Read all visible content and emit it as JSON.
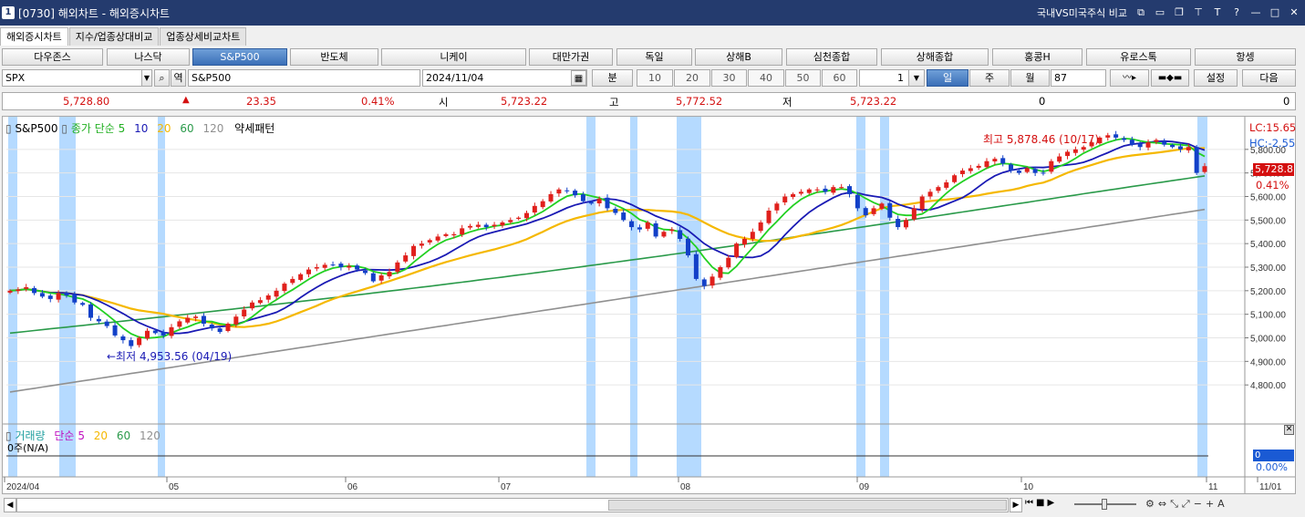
{
  "window": {
    "id": "1",
    "title": "[0730]  해외차트 - 해외증시차트",
    "right_label": "국내VS미국주식 비교"
  },
  "tabs": [
    "해외증시차트",
    "지수/업종상대비교",
    "업종상세비교차트"
  ],
  "markets": [
    "다우존스",
    "나스닥",
    "S&P500",
    "반도체",
    "니케이",
    "대만가권",
    "독일",
    "상해B",
    "심천종합",
    "상해종합",
    "홍콩H",
    "유로스톡",
    "항셍"
  ],
  "active_market": 2,
  "symbol": {
    "code": "SPX",
    "name": "S&P500",
    "date": "2024/11/04",
    "unit": "분"
  },
  "minute_options": [
    "10",
    "20",
    "30",
    "40",
    "50",
    "60"
  ],
  "count_value": "1",
  "periods": [
    "일",
    "주",
    "월"
  ],
  "period_count": "87",
  "buttons": {
    "settings": "설정",
    "next": "다음"
  },
  "quote": {
    "price": "5,728.80",
    "change_arrow": "▲",
    "change": "23.35",
    "change_pct": "0.41%",
    "open_label": "시",
    "open": "5,723.22",
    "high_label": "고",
    "high": "5,772.52",
    "low_label": "저",
    "low": "5,723.22",
    "volume": "0",
    "volume2": "0"
  },
  "legend": {
    "name": "S&P500",
    "ma_label": "종가 단순",
    "ma": [
      "5",
      "10",
      "20",
      "60",
      "120"
    ],
    "pattern": "약세패턴"
  },
  "vol_legend": {
    "name": "거래량",
    "ma_label": "단순",
    "ma": [
      "5",
      "20",
      "60",
      "120"
    ],
    "value": "0주(N/A)"
  },
  "annotations": {
    "high": "최고 5,878.46 (10/17)",
    "low": "←최저 4,953.56 (04/19)"
  },
  "right_axis": {
    "lc": "LC:15.65",
    "hc": "HC:-2.55",
    "price_tag": "5,728.8",
    "pct": "0.41%",
    "vol_tag": "0",
    "vol_pct": "0.00%"
  },
  "y_ticks": [
    "5,800.00",
    "5,700.00",
    "5,600.00",
    "5,500.00",
    "5,400.00",
    "5,300.00",
    "5,200.00",
    "5,100.00",
    "5,000.00",
    "4,900.00",
    "4,800.00"
  ],
  "x_ticks": [
    "2024/04",
    "05",
    "06",
    "07",
    "08",
    "09",
    "10",
    "11",
    "11/01"
  ],
  "colors": {
    "up": "#e0201c",
    "down": "#1240c8",
    "ma5": "#22d022",
    "ma10": "#1a1ab4",
    "ma20": "#f5b800",
    "ma60": "#2a9a4a",
    "ma120": "#909090",
    "highlight": "#a8d4ff"
  },
  "chart_data": {
    "type": "candlestick",
    "x_range": [
      "2024/04",
      "2024/11/04"
    ],
    "ylim": [
      4700,
      5900
    ],
    "high": {
      "value": 5878.46,
      "date": "10/17"
    },
    "low": {
      "value": 4953.56,
      "date": "04/19"
    },
    "last": 5728.8,
    "closes": [
      5200,
      5205,
      5215,
      5190,
      5175,
      5165,
      5190,
      5180,
      5150,
      5140,
      5085,
      5070,
      5050,
      5010,
      4990,
      4965,
      5000,
      5030,
      5020,
      5010,
      5045,
      5070,
      5085,
      5090,
      5060,
      5040,
      5025,
      5060,
      5090,
      5120,
      5150,
      5160,
      5180,
      5200,
      5230,
      5250,
      5270,
      5290,
      5300,
      5310,
      5310,
      5300,
      5305,
      5290,
      5275,
      5240,
      5265,
      5280,
      5320,
      5350,
      5390,
      5400,
      5415,
      5430,
      5440,
      5440,
      5465,
      5475,
      5480,
      5470,
      5480,
      5490,
      5500,
      5510,
      5530,
      5560,
      5580,
      5610,
      5630,
      5625,
      5605,
      5580,
      5570,
      5590,
      5550,
      5530,
      5500,
      5470,
      5460,
      5490,
      5430,
      5450,
      5460,
      5420,
      5350,
      5250,
      5220,
      5260,
      5300,
      5340,
      5400,
      5420,
      5450,
      5490,
      5540,
      5570,
      5600,
      5610,
      5620,
      5630,
      5630,
      5620,
      5640,
      5640,
      5610,
      5550,
      5520,
      5550,
      5570,
      5510,
      5470,
      5500,
      5550,
      5600,
      5620,
      5640,
      5660,
      5690,
      5710,
      5720,
      5730,
      5750,
      5760,
      5740,
      5710,
      5700,
      5720,
      5700,
      5700,
      5750,
      5770,
      5790,
      5800,
      5810,
      5830,
      5850,
      5860,
      5850,
      5840,
      5820,
      5810,
      5830,
      5840,
      5820,
      5810,
      5800,
      5810,
      5700,
      5728.8
    ]
  }
}
